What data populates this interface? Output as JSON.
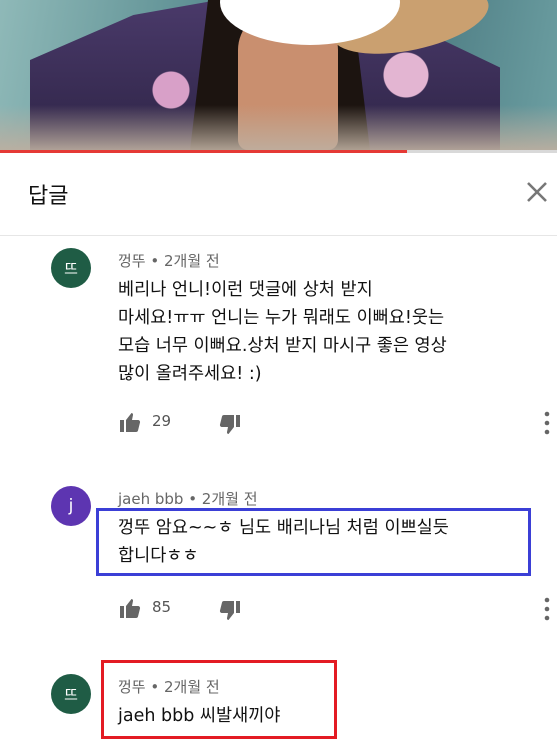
{
  "video": {
    "progress_fraction": 0.73,
    "accent": "#e53935"
  },
  "header": {
    "title": "답글",
    "close_icon": "close-icon"
  },
  "comments": [
    {
      "avatar_letter": "뜨",
      "meta": "껑뚜 • 2개월 전",
      "lines": [
        "베리나 언니!이런 댓글에 상처 받지",
        "마세요!ㅠㅠ 언니는 누가 뭐래도 이뻐요!웃는",
        "모습 너무 이뻐요.상처 받지 마시구 좋은 영상",
        "많이 올려주세요! :)"
      ],
      "likes": "29"
    },
    {
      "avatar_letter": "j",
      "meta": "jaeh bbb • 2개월 전",
      "lines": [
        "껑뚜 암요~~ㅎ 님도 배리나님 처럼 이쁘실듯",
        "합니다ㅎㅎ"
      ],
      "likes": "85"
    },
    {
      "avatar_letter": "뜨",
      "meta": "껑뚜 • 2개월 전",
      "lines": [
        "jaeh bbb 씨발새끼야"
      ]
    }
  ],
  "colors": {
    "highlight_blue": "#3b3fd6",
    "highlight_red": "#e31b23",
    "avatar_green": "#1f5c45",
    "avatar_purple": "#5d35b1"
  }
}
